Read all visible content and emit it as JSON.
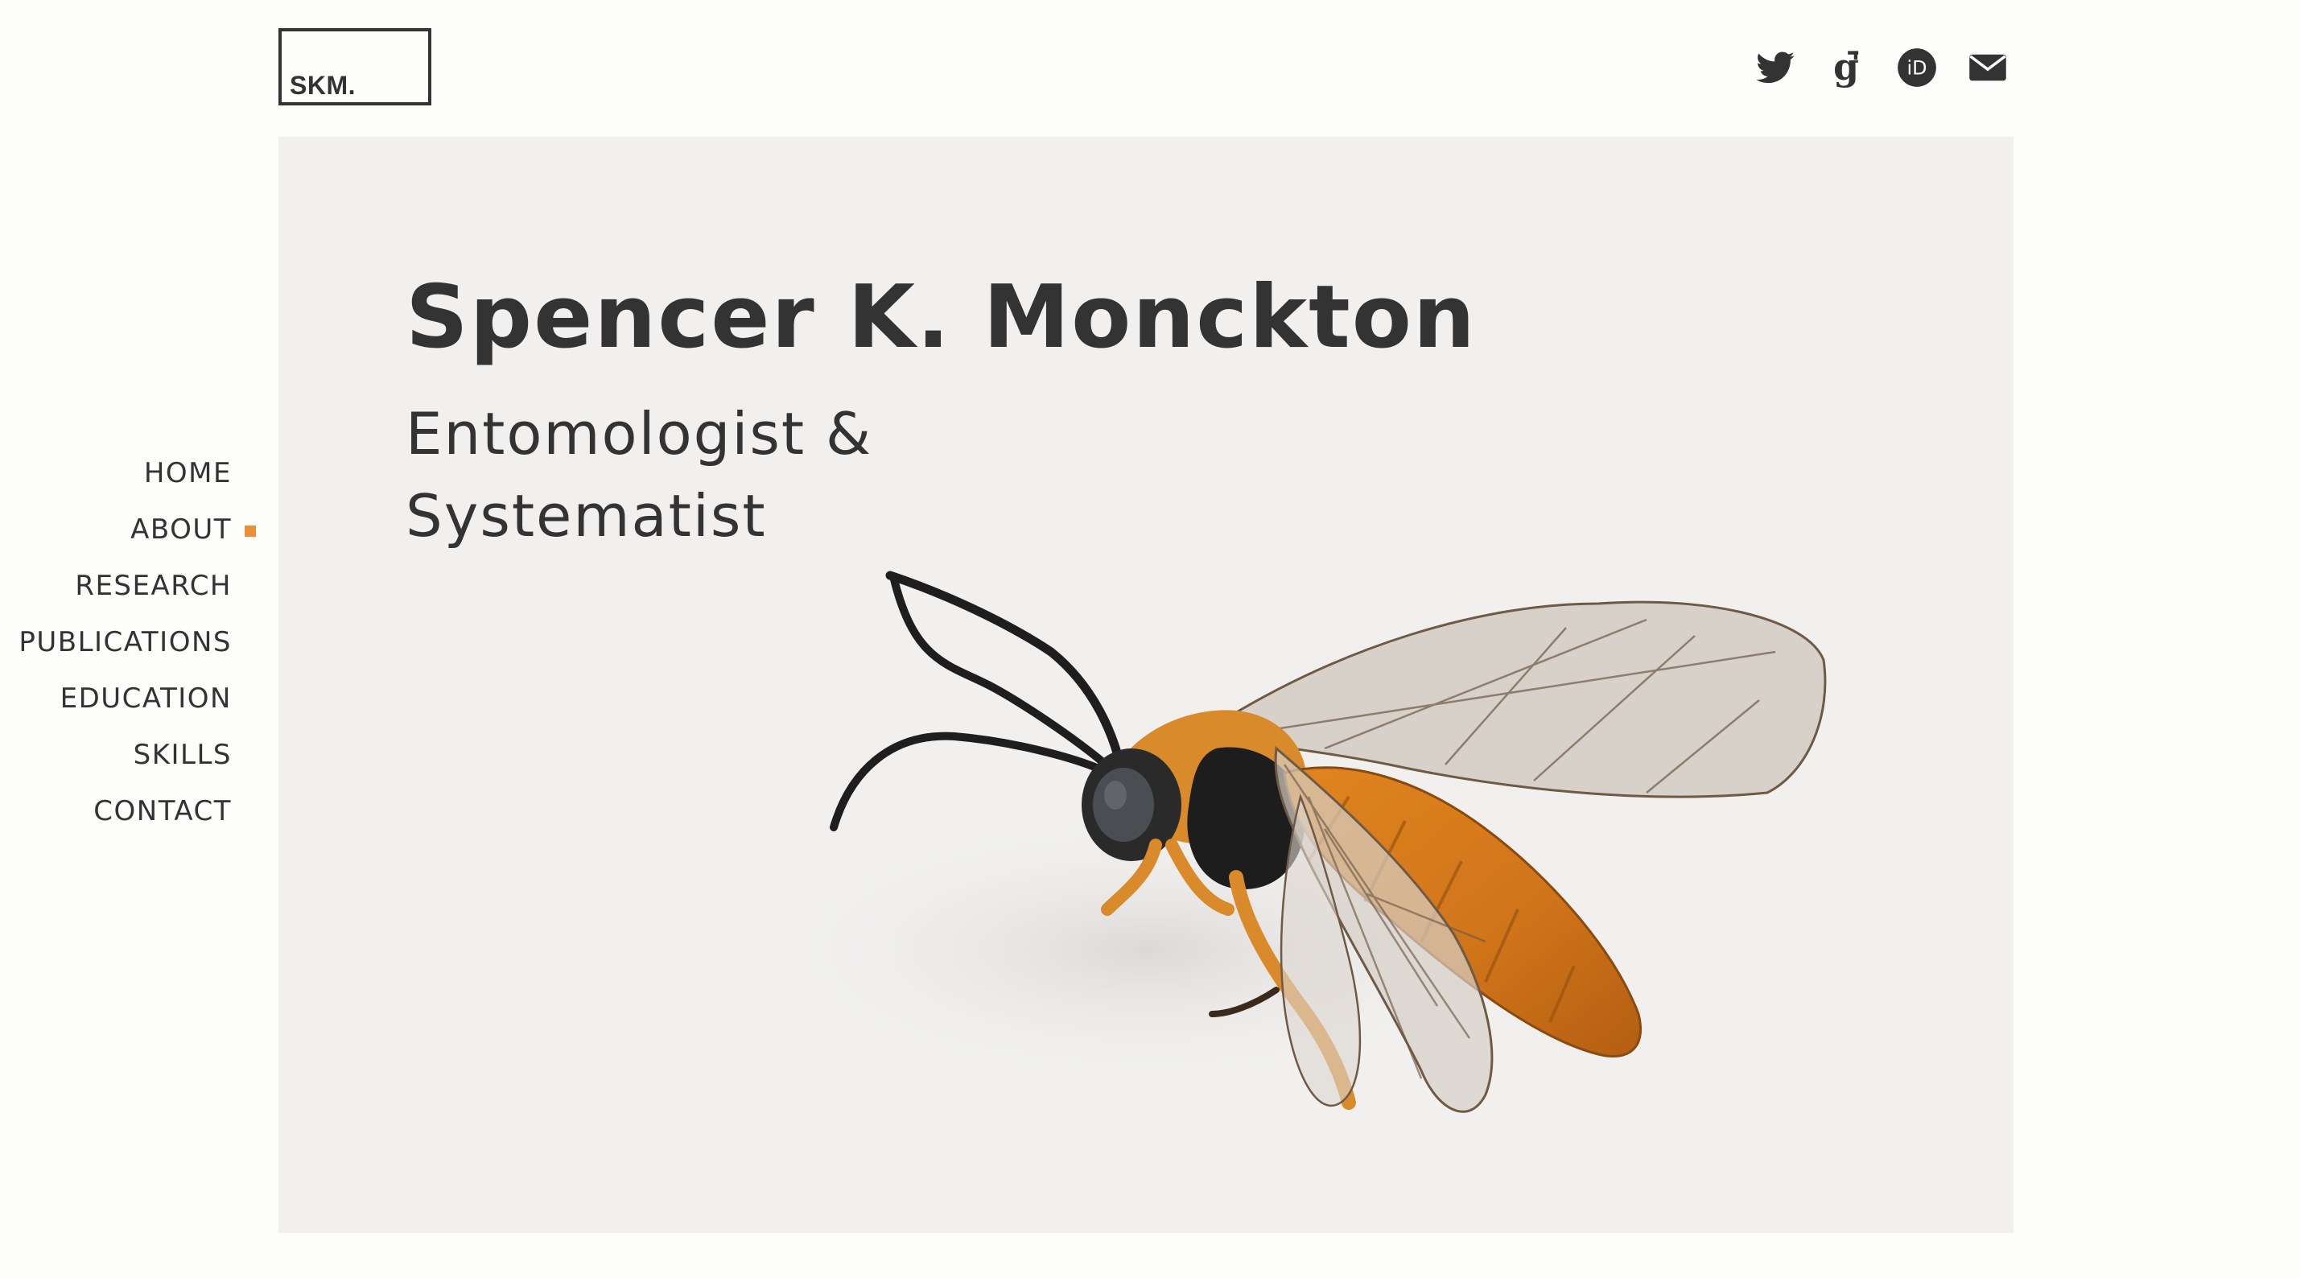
{
  "logo": {
    "text": "SKM."
  },
  "social": [
    {
      "name": "twitter-icon"
    },
    {
      "name": "google-scholar-icon"
    },
    {
      "name": "orcid-icon",
      "glyph": "iD"
    },
    {
      "name": "email-icon"
    }
  ],
  "nav": {
    "items": [
      {
        "label": "HOME"
      },
      {
        "label": "ABOUT",
        "active": true
      },
      {
        "label": "RESEARCH"
      },
      {
        "label": "PUBLICATIONS"
      },
      {
        "label": "EDUCATION"
      },
      {
        "label": "SKILLS"
      },
      {
        "label": "CONTACT"
      }
    ]
  },
  "hero": {
    "title": "Spencer K. Monckton",
    "subtitle": "Entomologist & Systematist",
    "image": "wasp-specimen"
  },
  "colors": {
    "text": "#333333",
    "accent": "#ec8d3a",
    "hero_background": "#f1f0ef",
    "page_background": "#fdfdfc"
  }
}
